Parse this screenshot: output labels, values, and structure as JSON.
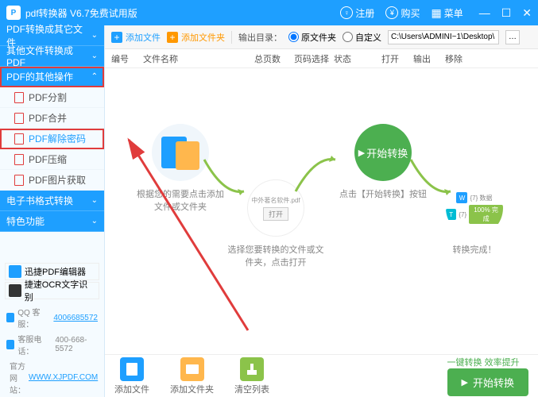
{
  "titlebar": {
    "title": "pdf转换器 V6.7免费试用版",
    "register": "注册",
    "buy": "购买",
    "menu": "菜单"
  },
  "sidebar": {
    "sections": [
      {
        "label": "PDF转换成其它文件",
        "expanded": false
      },
      {
        "label": "其他文件转换成PDF",
        "expanded": false
      },
      {
        "label": "PDF的其他操作",
        "expanded": true,
        "highlight": true
      },
      {
        "label": "电子书格式转换",
        "expanded": false
      },
      {
        "label": "特色功能",
        "expanded": false
      }
    ],
    "items": [
      {
        "label": "PDF分割"
      },
      {
        "label": "PDF合并"
      },
      {
        "label": "PDF解除密码",
        "highlight": true
      },
      {
        "label": "PDF压缩"
      },
      {
        "label": "PDF图片获取"
      }
    ],
    "ads": [
      {
        "label": "迅捷PDF编辑器"
      },
      {
        "label": "捷速OCR文字识别"
      }
    ],
    "contacts": {
      "qq_label": "QQ 客服：",
      "qq": "4006685572",
      "phone_label": "客服电话：",
      "phone": "400-668-5572",
      "site_label": "官方网站：",
      "site": "WWW.XJPDF.COM"
    }
  },
  "toolbar": {
    "add_file": "添加文件",
    "add_folder": "添加文件夹",
    "output_label": "输出目录：",
    "radio_original": "原文件夹",
    "radio_custom": "自定义",
    "path": "C:\\Users\\ADMINI~1\\Desktop\\"
  },
  "headers": [
    "编号",
    "文件名称",
    "总页数",
    "页码选择",
    "状态",
    "打开",
    "输出",
    "移除"
  ],
  "steps": {
    "s1": "根据您的需要点击添加文件或文件夹",
    "s2a": "中外著名软件.pdf",
    "s2_open": "打开",
    "s2": "选择您要转换的文件或文件夹，点击打开",
    "s3_btn": "开始转换",
    "s3": "点击【开始转换】按钮",
    "s4_r1": "{7}  数据",
    "s4_r2": "{7}",
    "s4_done": "100% 完成",
    "s4": "转换完成！"
  },
  "footer": {
    "add_file": "添加文件",
    "add_folder": "添加文件夹",
    "clear": "清空列表",
    "hint": "一键转换 效率提升",
    "start": "开始转换"
  }
}
